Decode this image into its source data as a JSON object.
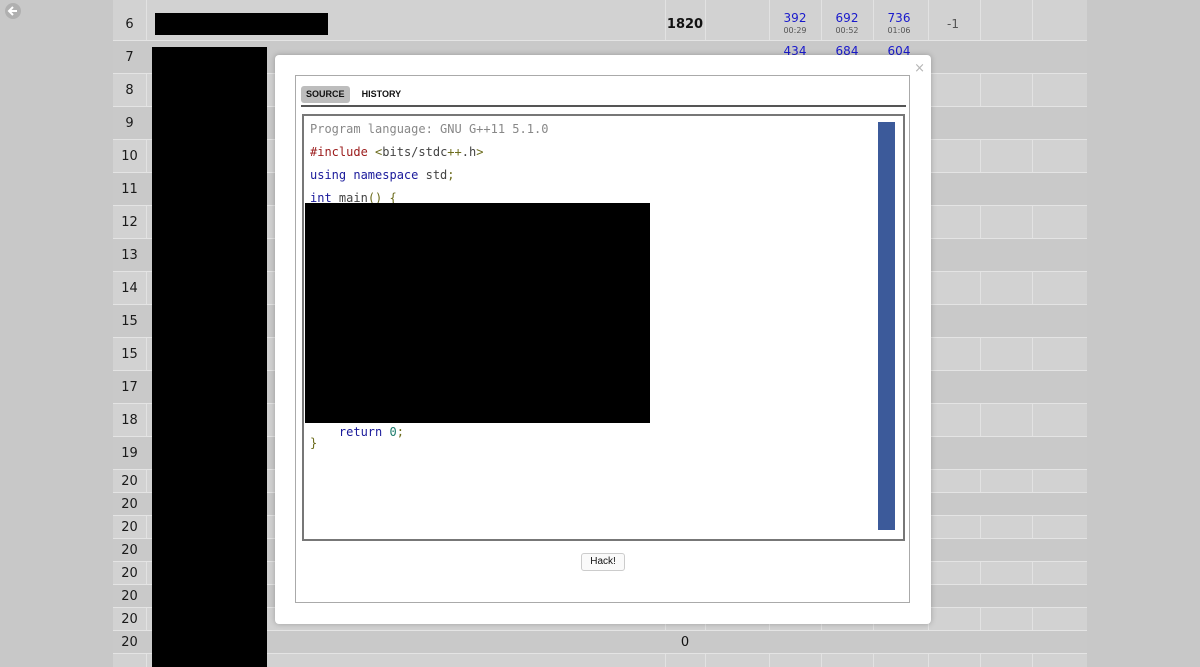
{
  "standings": {
    "rows": [
      {
        "rank": "6",
        "score": "1820",
        "problems": [
          {
            "points": "392",
            "time": "00:29"
          },
          {
            "points": "692",
            "time": "00:52"
          },
          {
            "points": "736",
            "time": "01:06"
          }
        ],
        "hacks": "-1"
      },
      {
        "rank": "7",
        "score": "",
        "problems": [
          {
            "points": "434",
            "time": ""
          },
          {
            "points": "684",
            "time": ""
          },
          {
            "points": "604",
            "time": ""
          }
        ],
        "hacks": ""
      },
      {
        "rank": "8"
      },
      {
        "rank": "9"
      },
      {
        "rank": "10"
      },
      {
        "rank": "11"
      },
      {
        "rank": "12"
      },
      {
        "rank": "13"
      },
      {
        "rank": "14"
      },
      {
        "rank": "15"
      },
      {
        "rank": "15"
      },
      {
        "rank": "17"
      },
      {
        "rank": "18"
      },
      {
        "rank": "19"
      },
      {
        "rank": "20"
      },
      {
        "rank": "20"
      },
      {
        "rank": "20"
      },
      {
        "rank": "20"
      },
      {
        "rank": "20"
      },
      {
        "rank": "20"
      },
      {
        "rank": "20"
      },
      {
        "rank": "20",
        "score": "0"
      }
    ]
  },
  "modal": {
    "close_label": "×",
    "tabs": [
      {
        "label": "SOURCE",
        "active": true
      },
      {
        "label": "HISTORY",
        "active": false
      }
    ],
    "code": {
      "language_line": "Program language: GNU G++11 5.1.0",
      "lines": [
        {
          "parts": [
            {
              "cls": "c-preproc",
              "text": "#include "
            },
            {
              "cls": "c-punct",
              "text": "<"
            },
            {
              "cls": "c-plain",
              "text": "bits/stdc"
            },
            {
              "cls": "c-punct",
              "text": "++"
            },
            {
              "cls": "c-plain",
              "text": ".h"
            },
            {
              "cls": "c-punct",
              "text": ">"
            }
          ]
        },
        {
          "parts": [
            {
              "cls": "c-keyword",
              "text": "using namespace "
            },
            {
              "cls": "c-plain",
              "text": "std"
            },
            {
              "cls": "c-punct",
              "text": ";"
            }
          ]
        },
        {
          "parts": [
            {
              "cls": "c-keyword",
              "text": "int "
            },
            {
              "cls": "c-plain",
              "text": "main"
            },
            {
              "cls": "c-punct",
              "text": "() {"
            }
          ]
        },
        {
          "parts": [
            {
              "cls": "c-keyword",
              "text": "    return "
            },
            {
              "cls": "c-num",
              "text": "0"
            },
            {
              "cls": "c-punct",
              "text": ";"
            }
          ]
        },
        {
          "parts": [
            {
              "cls": "c-punct",
              "text": "}"
            }
          ]
        }
      ]
    },
    "hack_button_label": "Hack!"
  },
  "colors": {
    "overlay_gray": "#c8c8c8",
    "scrollbar_blue": "#3c5a9a",
    "score_link_blue": "#1a1acc"
  }
}
